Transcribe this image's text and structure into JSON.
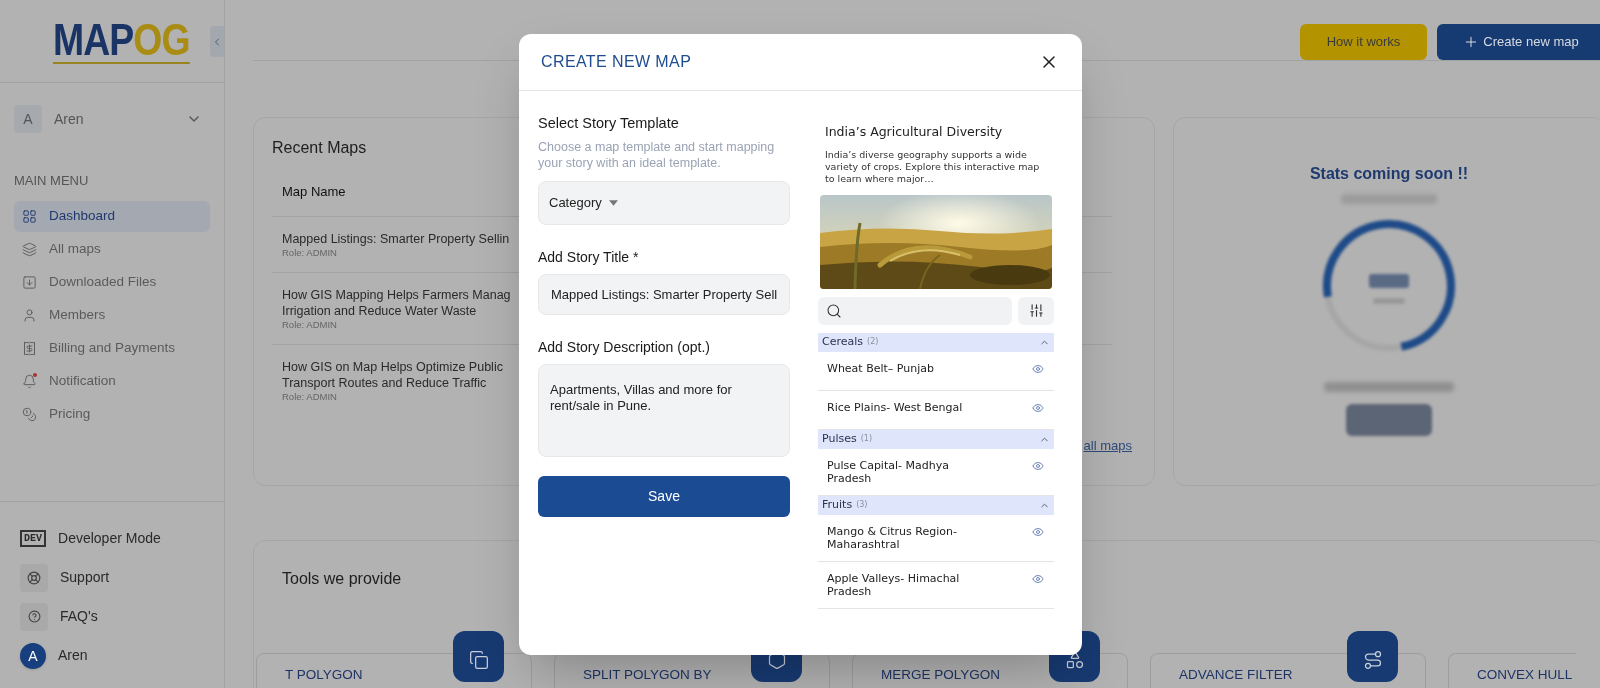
{
  "logo": {
    "left": "MAP",
    "right": "OG"
  },
  "user": {
    "initial": "A",
    "name": "Aren"
  },
  "main_menu": {
    "heading": "MAIN MENU",
    "items": [
      {
        "label": "Dashboard",
        "selected": true
      },
      {
        "label": "All maps",
        "selected": false
      },
      {
        "label": "Downloaded Files",
        "selected": false
      },
      {
        "label": "Members",
        "selected": false
      },
      {
        "label": "Billing and Payments",
        "selected": false
      },
      {
        "label": "Notification",
        "selected": false
      },
      {
        "label": "Pricing",
        "selected": false
      }
    ]
  },
  "sidebar_footer": [
    {
      "kind": "dev",
      "badge": "DEV",
      "label": "Developer Mode"
    },
    {
      "kind": "support",
      "label": "Support"
    },
    {
      "kind": "faq",
      "label": "FAQ's"
    },
    {
      "kind": "avatar",
      "initial": "A",
      "label": "Aren"
    }
  ],
  "header_buttons": [
    {
      "kind": "secondary",
      "label": "How it works"
    },
    {
      "kind": "primary",
      "label": "Create new map"
    }
  ],
  "recent_maps": {
    "title": "Recent Maps",
    "column": "Map Name",
    "rows": [
      {
        "lines": [
          "Mapped Listings: Smarter Property Sellin"
        ],
        "role": "Role: ADMIN"
      },
      {
        "lines": [
          "How GIS Mapping Helps Farmers Manag",
          "Irrigation and Reduce Water Waste"
        ],
        "role": "Role: ADMIN"
      },
      {
        "lines": [
          "How GIS on Map Helps Optimize Public",
          "Transport Routes and Reduce Traffic"
        ],
        "role": "Role: ADMIN"
      }
    ],
    "link": "all maps"
  },
  "stats": {
    "title": "Stats coming soon !!"
  },
  "tools": {
    "title": "Tools we provide",
    "cards": [
      {
        "label": "T POLYGON"
      },
      {
        "label": "SPLIT POLYGON BY"
      },
      {
        "label": "MERGE POLYGON"
      },
      {
        "label": "ADVANCE FILTER"
      },
      {
        "label": "CONVEX HULL"
      }
    ]
  },
  "modal": {
    "title": "CREATE NEW MAP",
    "template_heading": "Select Story Template",
    "template_hint": "Choose a map template and start mapping your story with an ideal template.",
    "category": {
      "value": "Category"
    },
    "title_label": "Add Story Title *",
    "title_value": "Mapped Listings: Smarter Property Sell",
    "description_label": "Add Story Description (opt.)",
    "description_value": "Apartments, Villas and more for rent/sale in Pune.",
    "save": "Save",
    "preview": {
      "title": "India’s Agricultural Diversity",
      "text": "India’s diverse geography supports a wide variety of crops. Explore this interactive map to learn where major…"
    },
    "groups": [
      {
        "name": "Cereals",
        "count": "(2)",
        "expanded": true,
        "items": [
          "Wheat Belt– Punjab",
          "Rice Plains- West Bengal"
        ]
      },
      {
        "name": "Pulses",
        "count": "(1)",
        "expanded": true,
        "items": [
          "Pulse Capital- Madhya Pradesh"
        ]
      },
      {
        "name": "Fruits",
        "count": "(3)",
        "expanded": true,
        "items": [
          "Mango & Citrus Region- Maharashtral",
          "Apple Valleys- Himachal Pradesh"
        ]
      }
    ]
  }
}
